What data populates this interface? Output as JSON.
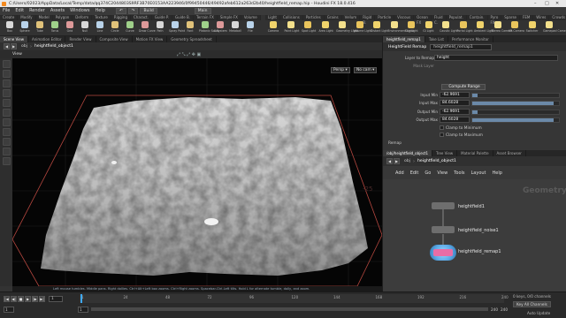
{
  "window": {
    "title": "C:/Users/02023/AppData/Local/Temp/data/qq374C2044803S9RF3B70E0153AA223946/0f99450446/49492afeb612a263d2b40/heightfield_remap.hip - Houdini FX 18.0.416",
    "controls": [
      "–",
      "□",
      "✕"
    ]
  },
  "menu": {
    "items": [
      "File",
      "Edit",
      "Render",
      "Assets",
      "Windows",
      "Help"
    ],
    "build_label": "Build",
    "desktop_label": "Main"
  },
  "shelf": {
    "tabs_left": [
      "Create",
      "Modify",
      "Model",
      "Polygon",
      "Deform",
      "Texture",
      "Rigging",
      "Charact.",
      "Guide P.",
      "Guide B.",
      "Terrain FX",
      "Simple FX",
      "Volume"
    ],
    "tabs_right": [
      "Light",
      "Collisions",
      "Particles",
      "Grains",
      "Vellum",
      "Rigid B.",
      "Particle",
      "Viscous",
      "Ocean FX",
      "Fluid C.",
      "Populat.",
      "Contain.",
      "Pyro FX",
      "Sparse",
      "FEM",
      "Wires",
      "Crowds",
      "Drive"
    ],
    "tools_left": [
      "Box",
      "Sphere",
      "Tube",
      "Torus",
      "Grid",
      "Null",
      "Line",
      "Circle",
      "Curve",
      "Draw Curve",
      "Path",
      "Spray Paint",
      "Font",
      "Platonic Solids",
      "L-System",
      "Metaball",
      "File"
    ],
    "tools_right": [
      "Camera",
      "Point Light",
      "Spot Light",
      "Area Light",
      "Geometry Light",
      "Volume Light",
      "Distant Light",
      "Environment Light",
      "Sky Light",
      "GI Light",
      "Caustic Light",
      "Portal Light",
      "Ambient Light",
      "Stereo Camera",
      "VR Camera",
      "Switcher",
      "Gamepad Camera"
    ]
  },
  "viewport": {
    "tabs": [
      "Scene View",
      "Animation Editor",
      "Render View",
      "Composite View",
      "Motion FX View",
      "Geometry Spreadsheet"
    ],
    "active_tab": "Scene View",
    "path_context": "obj",
    "path_node": "heightfield_object1",
    "view_label": "View",
    "persp_label": "Persp ▾",
    "cam_label": "No cam ▾",
    "status_hint": "Left mouse tumbles. Middle pans. Right dollies. Ctrl+Alt+Left box zooms. Ctrl+Right zooms. Spacebar-Ctrl-Left tilts. Hold L for alternate tumble, dolly, and zoom.",
    "axis_label": "-25"
  },
  "params": {
    "tabs": [
      "heightfield_remap1",
      "Take List",
      "Performance Monitor"
    ],
    "node_type": "HeightField Remap",
    "node_name": "heightfield_remap1",
    "layer_to_remap_label": "Layer to Remap",
    "layer_to_remap_value": "height",
    "mask_layer_label": "Mask Layer",
    "compute_range_label": "Compute Range",
    "input_min_label": "Input Min",
    "input_min_value": "-62.9691",
    "input_max_label": "Input Max",
    "input_max_value": "84.6028",
    "output_min_label": "Output Min",
    "output_min_value": "-62.9691",
    "output_max_label": "Output Max",
    "output_max_value": "84.6028",
    "input_min_level": 0.06,
    "input_max_level": 0.94,
    "output_min_level": 0.06,
    "output_max_level": 0.94,
    "clamp_min_label": "Clamp to Minimum",
    "clamp_max_label": "Clamp to Maximum",
    "remap_label": "Remap"
  },
  "network": {
    "tabs": [
      "/obj/heightfield_object1",
      "Tree View",
      "Material Palette",
      "Asset Browser"
    ],
    "path_context": "obj",
    "path_node": "heightfield_object1",
    "menu": [
      "Add",
      "Edit",
      "Go",
      "View",
      "Tools",
      "Layout",
      "Help"
    ],
    "watermark": "Geometry",
    "nodes": [
      {
        "name": "heightfield1",
        "flag": "a"
      },
      {
        "name": "heightfield_noise1",
        "flag": "a"
      },
      {
        "name": "heightfield_remap1",
        "flag": "a"
      }
    ]
  },
  "timeline": {
    "frame": "1",
    "start": "1",
    "end_a": "240",
    "end_b": "240",
    "ticks": [
      "1",
      "24",
      "48",
      "72",
      "96",
      "120",
      "144",
      "168",
      "192",
      "216",
      "240"
    ],
    "keys_info": "0 keys, 0/0 channels",
    "key_all_label": "Key All Channels",
    "auto_update_label": "Auto Update"
  },
  "colors": {
    "accent": "#f48a1f",
    "selection_blue": "#6b89a8",
    "node_remap": "#5aa9e6",
    "bbox_red": "#b5473f"
  }
}
